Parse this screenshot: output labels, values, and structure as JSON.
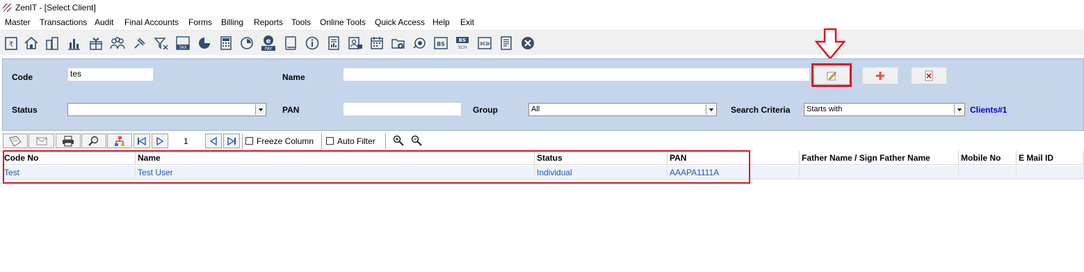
{
  "window": {
    "title": "ZenIT - [Select Client]"
  },
  "menu": {
    "items": [
      "Master",
      "Transactions",
      "Audit",
      "Final Accounts",
      "Forms",
      "Billing",
      "Reports",
      "Tools",
      "Online Tools",
      "Quick Access",
      "Help",
      "Exit"
    ]
  },
  "toolbar": {
    "icons": [
      "rupee-book-icon",
      "home-icon",
      "buildings-icon",
      "bar-chart-icon",
      "gift-icon",
      "group-icon",
      "pin-icon",
      "filter-icon",
      "tax-icon",
      "pie-icon",
      "calculator-icon",
      "clock-icon",
      "epay-icon",
      "book-icon",
      "info-icon",
      "report-icon",
      "user-card-icon",
      "calendar-icon",
      "folder-add-icon",
      "refresh-icon",
      "bs-icon",
      "bs-sch-icon",
      "3cd-icon",
      "ledger-icon",
      "close-icon"
    ],
    "tax_text": "TAX",
    "epay_text": "e PAY",
    "bs_text": "BS",
    "bs_sch_text": "BS SCH",
    "cd3_text": "3CD"
  },
  "criteria": {
    "code_label": "Code",
    "code_value": "tes",
    "name_label": "Name",
    "name_value": "",
    "status_label": "Status",
    "status_value": "",
    "pan_label": "PAN",
    "pan_value": "",
    "group_label": "Group",
    "group_value": "All",
    "search_criteria_label": "Search Criteria",
    "search_criteria_value": "Starts with",
    "clients_count": "Clients#1",
    "edit_button_icon": "pencil-icon",
    "add_button_icon": "plus-icon",
    "delete_button_icon": "delete-icon"
  },
  "gridbar": {
    "page_number": "1",
    "freeze_column_label": "Freeze Column",
    "auto_filter_label": "Auto Filter"
  },
  "grid": {
    "columns": [
      "Code No",
      "Name",
      "Status",
      "PAN",
      "Father Name / Sign Father Name",
      "Mobile No",
      "E Mail ID"
    ],
    "rows": [
      [
        "Test",
        "Test User",
        "Individual",
        "AAAPA1111A",
        "",
        "",
        ""
      ]
    ]
  },
  "colors": {
    "panel_bg": "#c5d5eb",
    "highlight": "#e01020",
    "link_text": "#1a55b0",
    "count_text": "#0000d0"
  }
}
